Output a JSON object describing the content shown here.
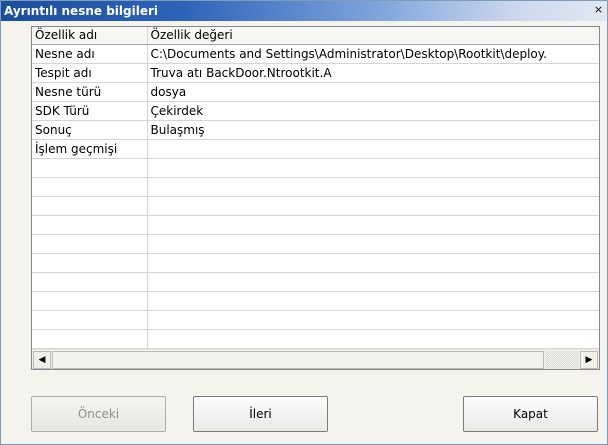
{
  "window": {
    "title": "Ayrıntılı nesne bilgileri",
    "close_glyph": "×"
  },
  "grid": {
    "columns": [
      "Özellik adı",
      "Özellik değeri"
    ],
    "rows": [
      [
        "Nesne adı",
        "C:\\Documents and Settings\\Administrator\\Desktop\\Rootkit\\deploy."
      ],
      [
        "Tespit adı",
        "Truva atı BackDoor.Ntrootkit.A"
      ],
      [
        "Nesne türü",
        "dosya"
      ],
      [
        "SDK Türü",
        "Çekirdek"
      ],
      [
        "Sonuç",
        "Bulaşmış"
      ],
      [
        "İşlem geçmişi",
        ""
      ],
      [
        "",
        ""
      ],
      [
        "",
        ""
      ],
      [
        "",
        ""
      ],
      [
        "",
        ""
      ],
      [
        "",
        ""
      ],
      [
        "",
        ""
      ],
      [
        "",
        ""
      ],
      [
        "",
        ""
      ],
      [
        "",
        ""
      ],
      [
        "",
        ""
      ],
      [
        "",
        ""
      ]
    ]
  },
  "scrollbar": {
    "left_arrow": "◀",
    "right_arrow": "▶"
  },
  "buttons": {
    "previous": "Önceki",
    "next": "İleri",
    "close": "Kapat"
  }
}
